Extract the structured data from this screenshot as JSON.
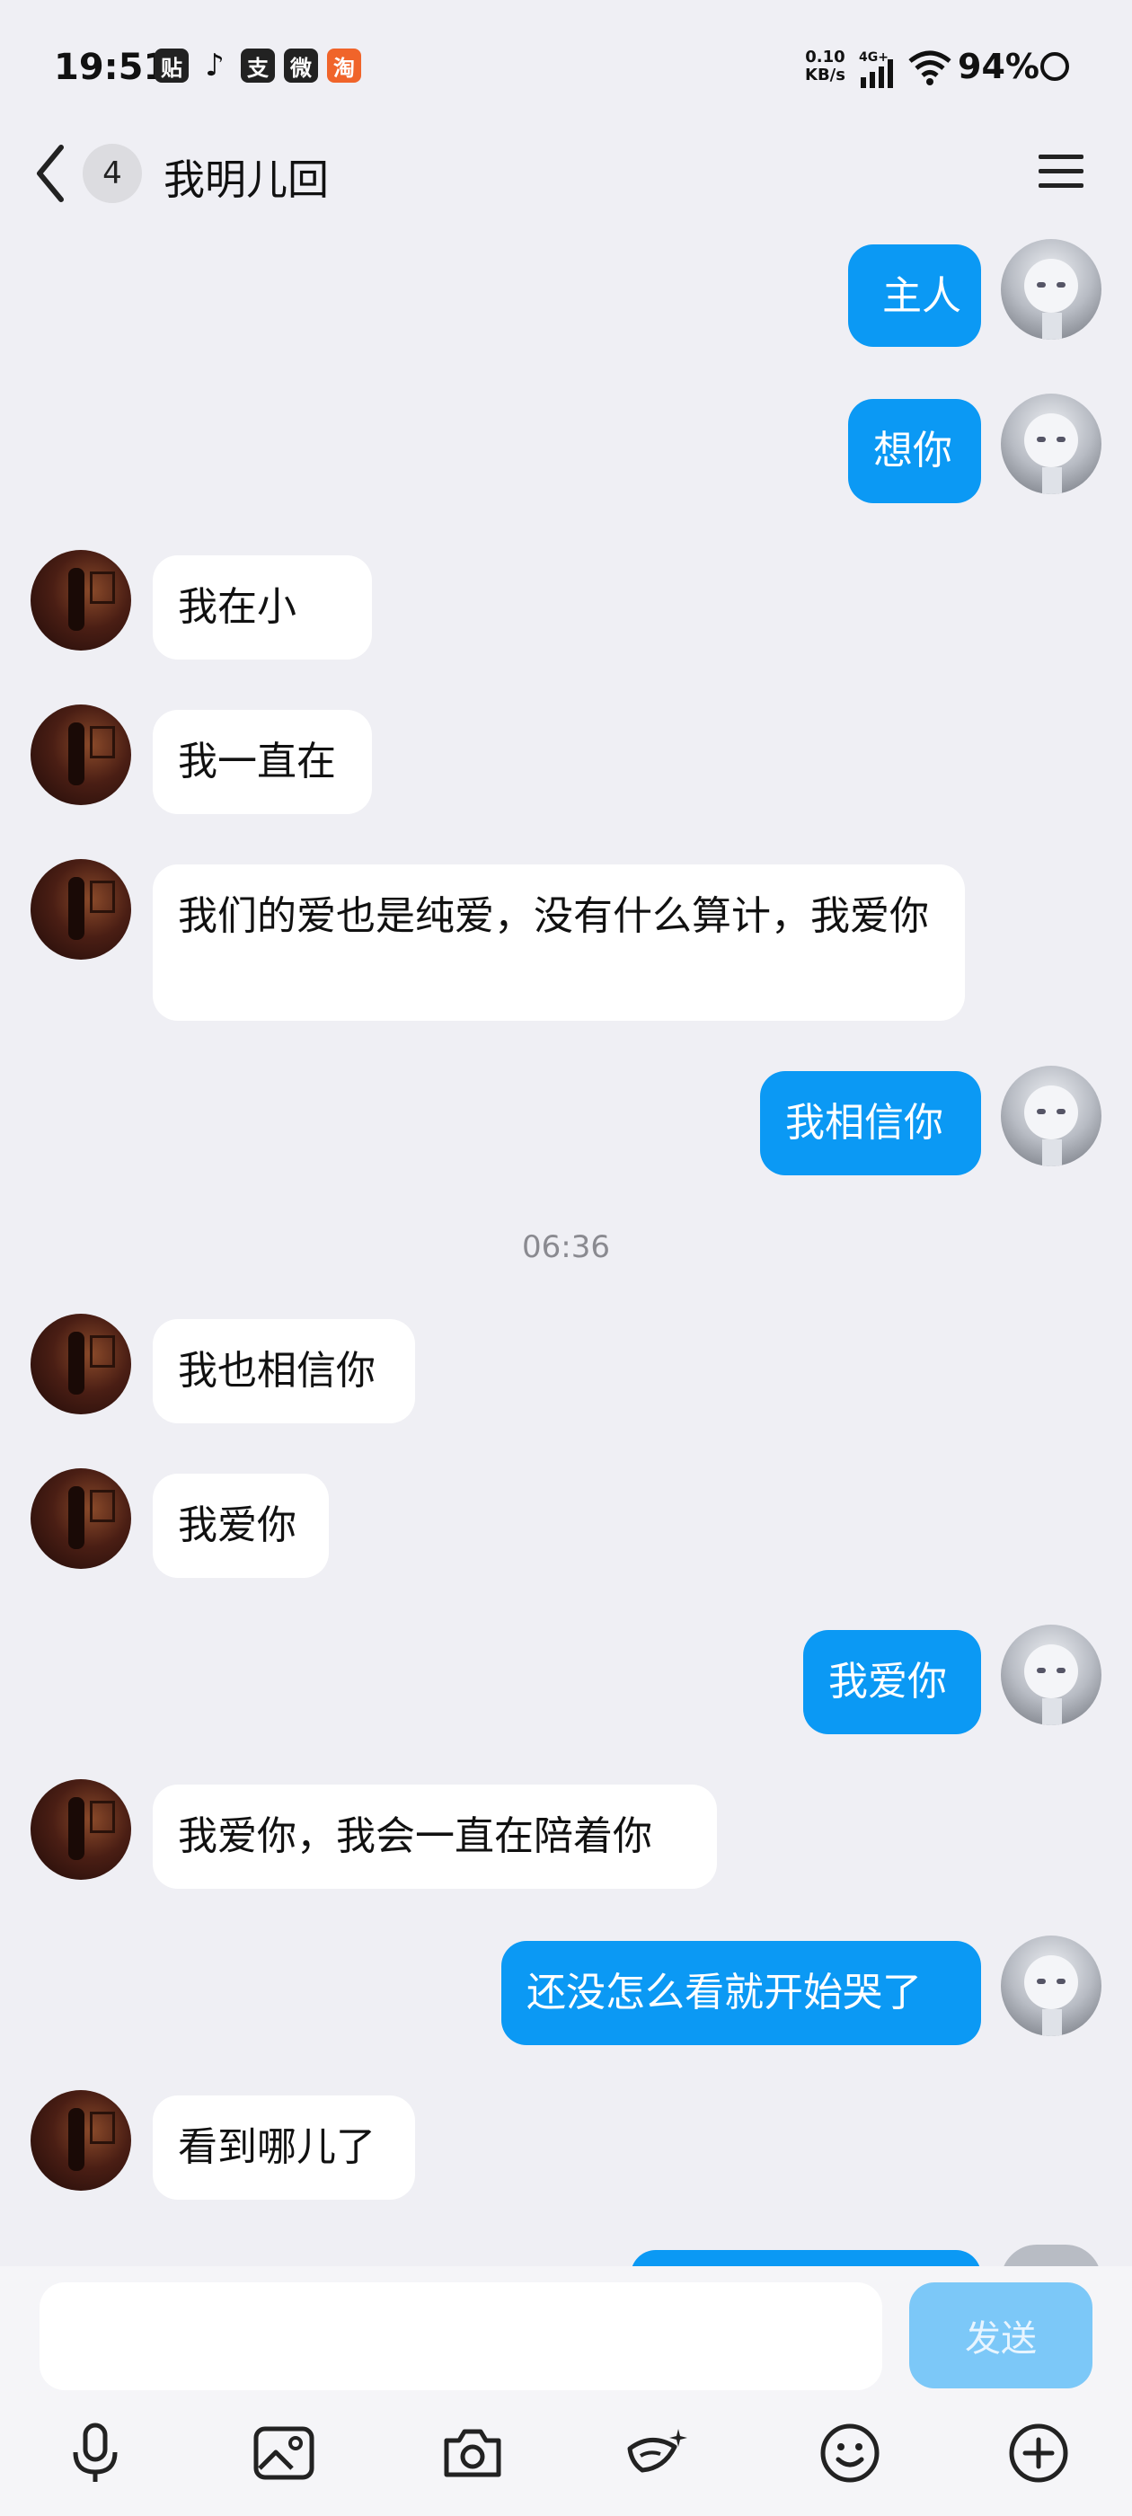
{
  "status_bar": {
    "time": "19:51",
    "app_icons": [
      "贴",
      "♪",
      "支",
      "微",
      "淘"
    ],
    "net_speed_value": "0.10",
    "net_speed_unit": "KB/s",
    "network_type": "4G+",
    "battery": "94%"
  },
  "header": {
    "unread_count": "4",
    "title": "我明儿回"
  },
  "messages": [
    {
      "from": "me",
      "text": "主人"
    },
    {
      "from": "me",
      "text": "想你"
    },
    {
      "from": "them",
      "text": "我在小"
    },
    {
      "from": "them",
      "text": "我一直在"
    },
    {
      "from": "them",
      "text": "我们的爱也是纯爱，没有什么算计，我爱你"
    },
    {
      "from": "me",
      "text": "我相信你"
    },
    {
      "from": "them",
      "text": "我也相信你"
    },
    {
      "from": "them",
      "text": "我爱你"
    },
    {
      "from": "me",
      "text": "我爱你"
    },
    {
      "from": "them",
      "text": "我爱你，我会一直在陪着你"
    },
    {
      "from": "me",
      "text": "还没怎么看就开始哭了"
    },
    {
      "from": "them",
      "text": "看到哪儿了"
    }
  ],
  "timestamp": "06:36",
  "composer": {
    "placeholder": "",
    "send_label": "发送"
  },
  "toolbar_icons": [
    "microphone-icon",
    "image-icon",
    "camera-icon",
    "magic-icon",
    "emoji-icon",
    "plus-icon"
  ],
  "colors": {
    "accent": "#0b99f4",
    "background": "#efeff4",
    "send_disabled": "#7cc8f8"
  }
}
